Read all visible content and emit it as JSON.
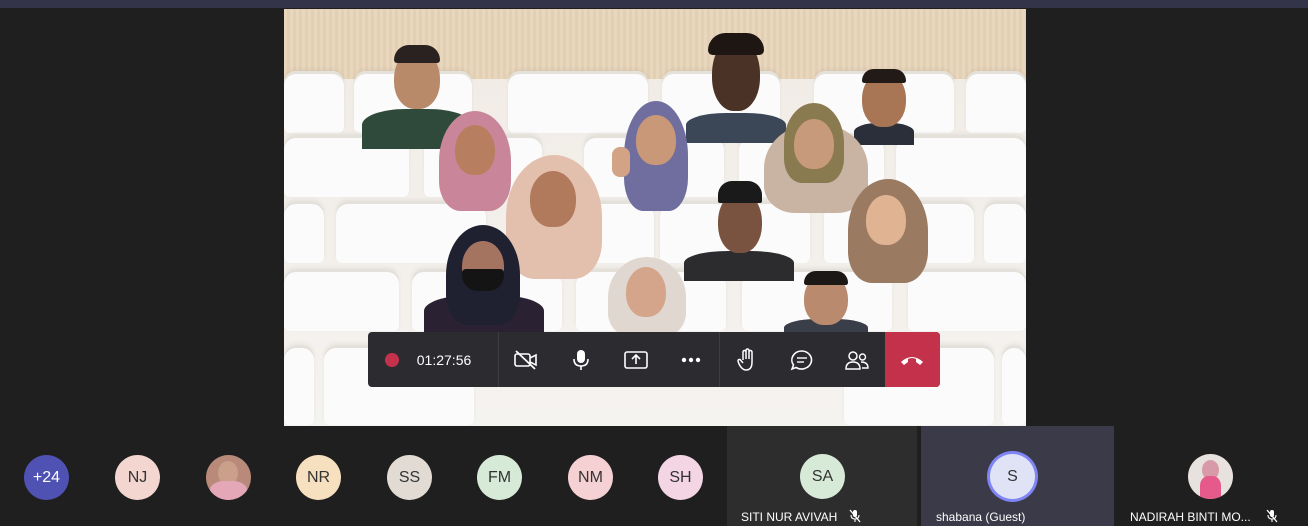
{
  "call": {
    "timer": "01:27:56"
  },
  "controls": {
    "record_icon": "record-icon",
    "camera_icon": "camera-off-icon",
    "mic_icon": "mic-icon",
    "share_icon": "share-screen-icon",
    "more_icon": "more-icon",
    "raise_hand_icon": "raise-hand-icon",
    "chat_icon": "chat-icon",
    "people_icon": "people-icon",
    "hangup_icon": "hang-up-icon",
    "hangup_color": "#c4314b"
  },
  "overflow": {
    "label": "+24",
    "color": "#4f52b2"
  },
  "avatars": [
    {
      "initials": "NJ",
      "color": "#f3d6d0"
    },
    {
      "initials": "",
      "color": "#b98a7a"
    },
    {
      "initials": "NR",
      "color": "#f6e0bf"
    },
    {
      "initials": "SS",
      "color": "#e2dbd3"
    },
    {
      "initials": "FM",
      "color": "#d6ead7"
    },
    {
      "initials": "NM",
      "color": "#f5d1d3"
    },
    {
      "initials": "SH",
      "color": "#f3d5e4"
    }
  ],
  "tiles": [
    {
      "initials": "SA",
      "name": "SITI NUR AVIVAH",
      "color": "#d6ead7",
      "muted": true
    },
    {
      "initials": "S",
      "name": "shabana (Guest)",
      "color": "#dfe3f5",
      "muted": false
    },
    {
      "initials": "",
      "name": "NADIRAH BINTI MO...",
      "color": "#e8e2df",
      "muted": true
    }
  ]
}
